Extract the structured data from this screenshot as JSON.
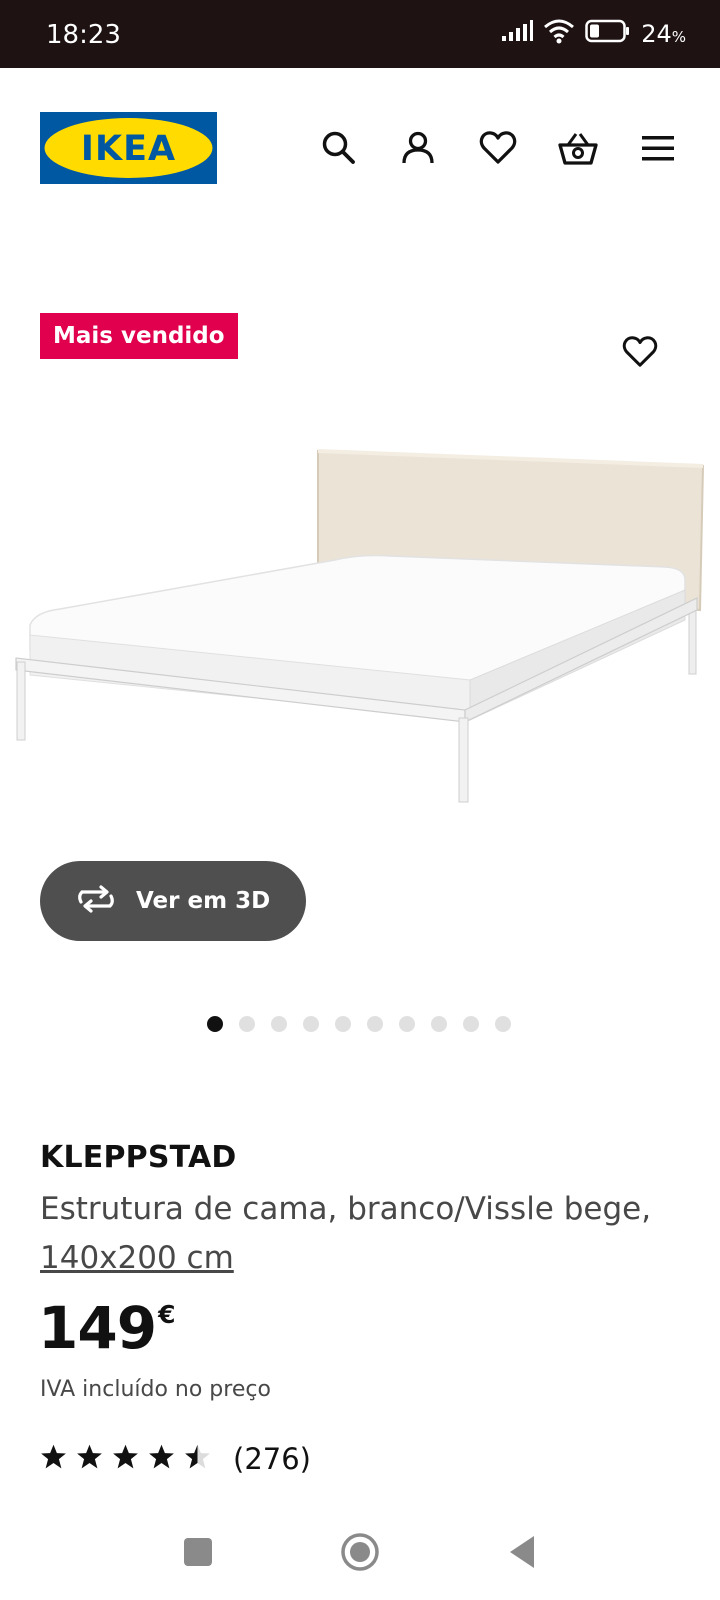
{
  "status_bar": {
    "time": "18:23",
    "battery_percent": "24",
    "battery_unit": "%",
    "icons": [
      "signal-icon",
      "wifi-icon",
      "battery-icon"
    ]
  },
  "header": {
    "logo_text": "IKEA",
    "brand_colors": {
      "blue": "#0058a3",
      "yellow": "#ffdb00"
    },
    "icons": [
      "search-icon",
      "account-icon",
      "wishlist-icon",
      "cart-icon",
      "menu-icon"
    ]
  },
  "product": {
    "badge": "Mais vendido",
    "badge_color": "#e0004d",
    "name": "KLEPPSTAD",
    "description": "Estrutura de cama, branco/Vissle bege,",
    "size": "140x200 cm",
    "price_integer": "149",
    "price_currency": "€",
    "vat_note": "IVA incluído no preço",
    "rating": 4.5,
    "rating_max": 5,
    "review_count": "(276)"
  },
  "gallery": {
    "view_3d_label": "Ver em 3D",
    "image_count": 10,
    "active_index": 0
  },
  "system_nav": {
    "icons": [
      "recents-icon",
      "home-icon",
      "back-icon"
    ]
  }
}
